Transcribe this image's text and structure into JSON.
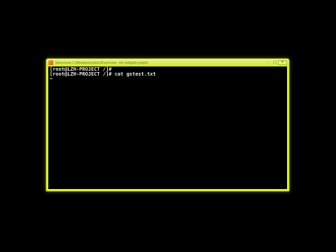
{
  "window": {
    "title": "Seleccionar C:\\Windows\\system32\\cmd.exe - ssh root@lzh-project",
    "caption_buttons": {
      "minimize": "–",
      "maximize": "□",
      "close": "✕"
    }
  },
  "console": {
    "lines": [
      "[root@LZH-PROJECT /]#",
      "[root@LZH-PROJECT /]# cat gstest.txt"
    ]
  },
  "colors": {
    "window_frame": "#d8ee3a",
    "console_background": "#000000",
    "console_text": "#e8e8e8",
    "desktop_background": "#000000"
  }
}
